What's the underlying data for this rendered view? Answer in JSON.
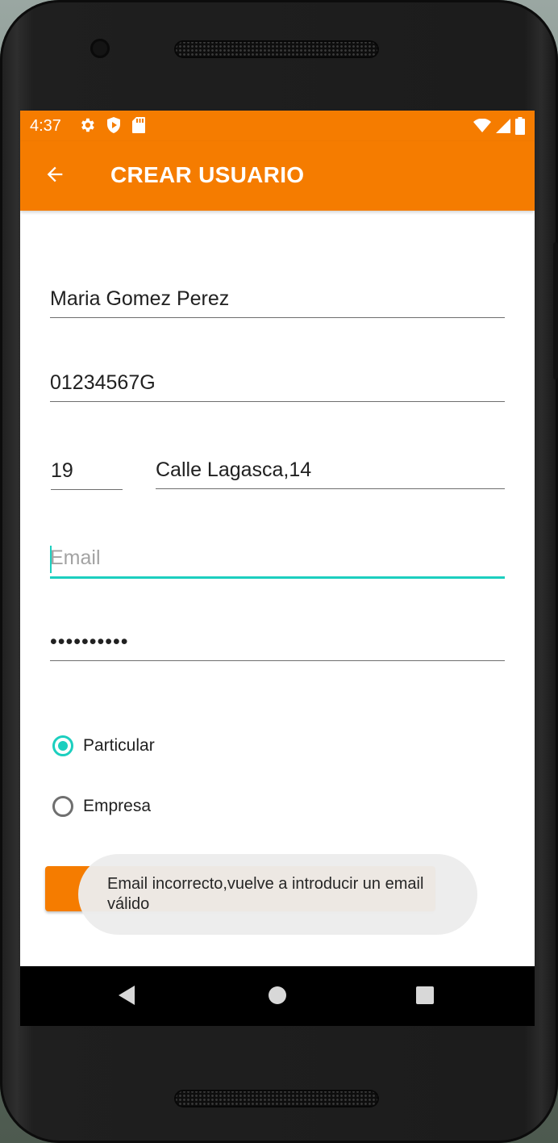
{
  "status_bar": {
    "time": "4:37",
    "left_icons": [
      "settings-icon",
      "shield-icon",
      "sd-card-icon"
    ],
    "right_icons": [
      "wifi-icon",
      "signal-icon",
      "battery-icon"
    ]
  },
  "app_bar": {
    "title": "CREAR USUARIO",
    "back_icon": "arrow-back-icon",
    "color": "#f57c00"
  },
  "form": {
    "name_value": "Maria Gomez Perez",
    "dni_value": "01234567G",
    "age_value": "19",
    "address_value": "Calle Lagasca,14",
    "email_placeholder": "Email",
    "email_value": "",
    "password_value": "••••••••••",
    "accent_color": "#1ccfbf",
    "user_type": {
      "options": [
        "Particular",
        "Empresa"
      ],
      "selected": "Particular"
    }
  },
  "toast": {
    "message": "Email incorrecto,vuelve a introducir un email válido"
  },
  "nav_bar": {
    "buttons": [
      "back-triangle-icon",
      "home-circle-icon",
      "recents-square-icon"
    ]
  }
}
